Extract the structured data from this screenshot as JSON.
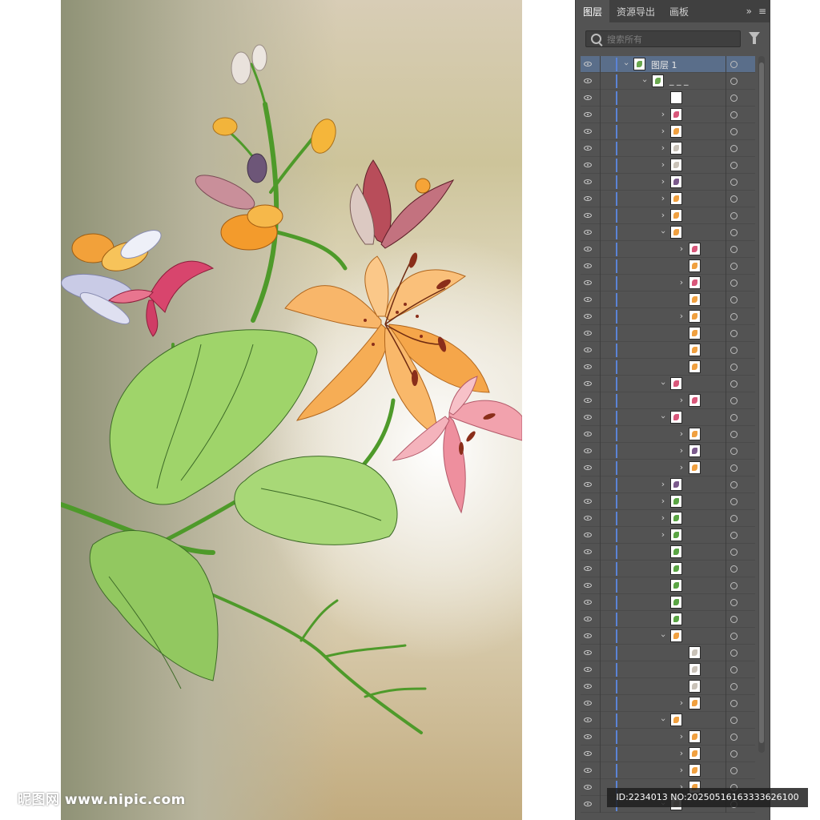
{
  "panel": {
    "tabs": [
      "图层",
      "资源导出",
      "画板"
    ],
    "active_tab": "图层",
    "tab_tools": {
      "collapse": "»",
      "menu": "≡"
    },
    "search_placeholder": "搜索所有",
    "layers": [
      {
        "label": "图层 1",
        "indent": 0,
        "toggle": "open",
        "thumb": "plant"
      },
      {
        "label": "_ _ _",
        "indent": 1,
        "toggle": "open",
        "thumb": "plant"
      },
      {
        "label": "",
        "indent": 2,
        "toggle": "none",
        "thumb": "frame"
      },
      {
        "label": "",
        "indent": 2,
        "toggle": "closed",
        "thumb": "pink"
      },
      {
        "label": "",
        "indent": 2,
        "toggle": "closed",
        "thumb": "orange"
      },
      {
        "label": "",
        "indent": 2,
        "toggle": "closed",
        "thumb": "white"
      },
      {
        "label": "",
        "indent": 2,
        "toggle": "closed",
        "thumb": "white"
      },
      {
        "label": "",
        "indent": 2,
        "toggle": "closed",
        "thumb": "purple"
      },
      {
        "label": "",
        "indent": 2,
        "toggle": "closed",
        "thumb": "orange"
      },
      {
        "label": "",
        "indent": 2,
        "toggle": "closed",
        "thumb": "orange"
      },
      {
        "label": "",
        "indent": 2,
        "toggle": "open",
        "thumb": "orange"
      },
      {
        "label": "",
        "indent": 3,
        "toggle": "closed",
        "thumb": "pink"
      },
      {
        "label": "",
        "indent": 3,
        "toggle": "none",
        "thumb": "orange"
      },
      {
        "label": "",
        "indent": 3,
        "toggle": "closed",
        "thumb": "pink"
      },
      {
        "label": "",
        "indent": 3,
        "toggle": "none",
        "thumb": "orange"
      },
      {
        "label": "",
        "indent": 3,
        "toggle": "closed",
        "thumb": "orange"
      },
      {
        "label": "",
        "indent": 3,
        "toggle": "none",
        "thumb": "orange"
      },
      {
        "label": "",
        "indent": 3,
        "toggle": "none",
        "thumb": "orange"
      },
      {
        "label": "",
        "indent": 3,
        "toggle": "none",
        "thumb": "orange"
      },
      {
        "label": "",
        "indent": 2,
        "toggle": "open",
        "thumb": "pink"
      },
      {
        "label": "",
        "indent": 3,
        "toggle": "closed",
        "thumb": "pink"
      },
      {
        "label": "",
        "indent": 2,
        "toggle": "open",
        "thumb": "pink"
      },
      {
        "label": "",
        "indent": 3,
        "toggle": "closed",
        "thumb": "orange"
      },
      {
        "label": "",
        "indent": 3,
        "toggle": "closed",
        "thumb": "purple"
      },
      {
        "label": "",
        "indent": 3,
        "toggle": "closed",
        "thumb": "orange"
      },
      {
        "label": "",
        "indent": 2,
        "toggle": "closed",
        "thumb": "purple"
      },
      {
        "label": "",
        "indent": 2,
        "toggle": "closed",
        "thumb": "green"
      },
      {
        "label": "",
        "indent": 2,
        "toggle": "closed",
        "thumb": "green"
      },
      {
        "label": "",
        "indent": 2,
        "toggle": "closed",
        "thumb": "green"
      },
      {
        "label": "",
        "indent": 2,
        "toggle": "none",
        "thumb": "green"
      },
      {
        "label": "",
        "indent": 2,
        "toggle": "none",
        "thumb": "green"
      },
      {
        "label": "",
        "indent": 2,
        "toggle": "none",
        "thumb": "green"
      },
      {
        "label": "",
        "indent": 2,
        "toggle": "none",
        "thumb": "green"
      },
      {
        "label": "",
        "indent": 2,
        "toggle": "none",
        "thumb": "green"
      },
      {
        "label": "",
        "indent": 2,
        "toggle": "open",
        "thumb": "orange"
      },
      {
        "label": "",
        "indent": 3,
        "toggle": "none",
        "thumb": "white"
      },
      {
        "label": "",
        "indent": 3,
        "toggle": "none",
        "thumb": "white"
      },
      {
        "label": "",
        "indent": 3,
        "toggle": "none",
        "thumb": "white"
      },
      {
        "label": "",
        "indent": 3,
        "toggle": "closed",
        "thumb": "orange"
      },
      {
        "label": "",
        "indent": 2,
        "toggle": "open",
        "thumb": "orange"
      },
      {
        "label": "",
        "indent": 3,
        "toggle": "closed",
        "thumb": "orange"
      },
      {
        "label": "",
        "indent": 3,
        "toggle": "closed",
        "thumb": "orange"
      },
      {
        "label": "",
        "indent": 3,
        "toggle": "closed",
        "thumb": "orange"
      },
      {
        "label": "",
        "indent": 3,
        "toggle": "closed",
        "thumb": "orange"
      },
      {
        "label": "",
        "indent": 2,
        "toggle": "open",
        "thumb": "white"
      }
    ]
  },
  "thumb_colors": {
    "plant": "#6aa84f",
    "frame": "#ffffff",
    "pink": "#d9577a",
    "orange": "#f0a040",
    "white": "#c9c2b8",
    "purple": "#7b5a8c",
    "green": "#5aa544"
  },
  "watermark": {
    "site": "昵图网 www.nipic.com"
  },
  "id_strip": {
    "text": "ID:2234013 NO:20250516163333626100"
  }
}
